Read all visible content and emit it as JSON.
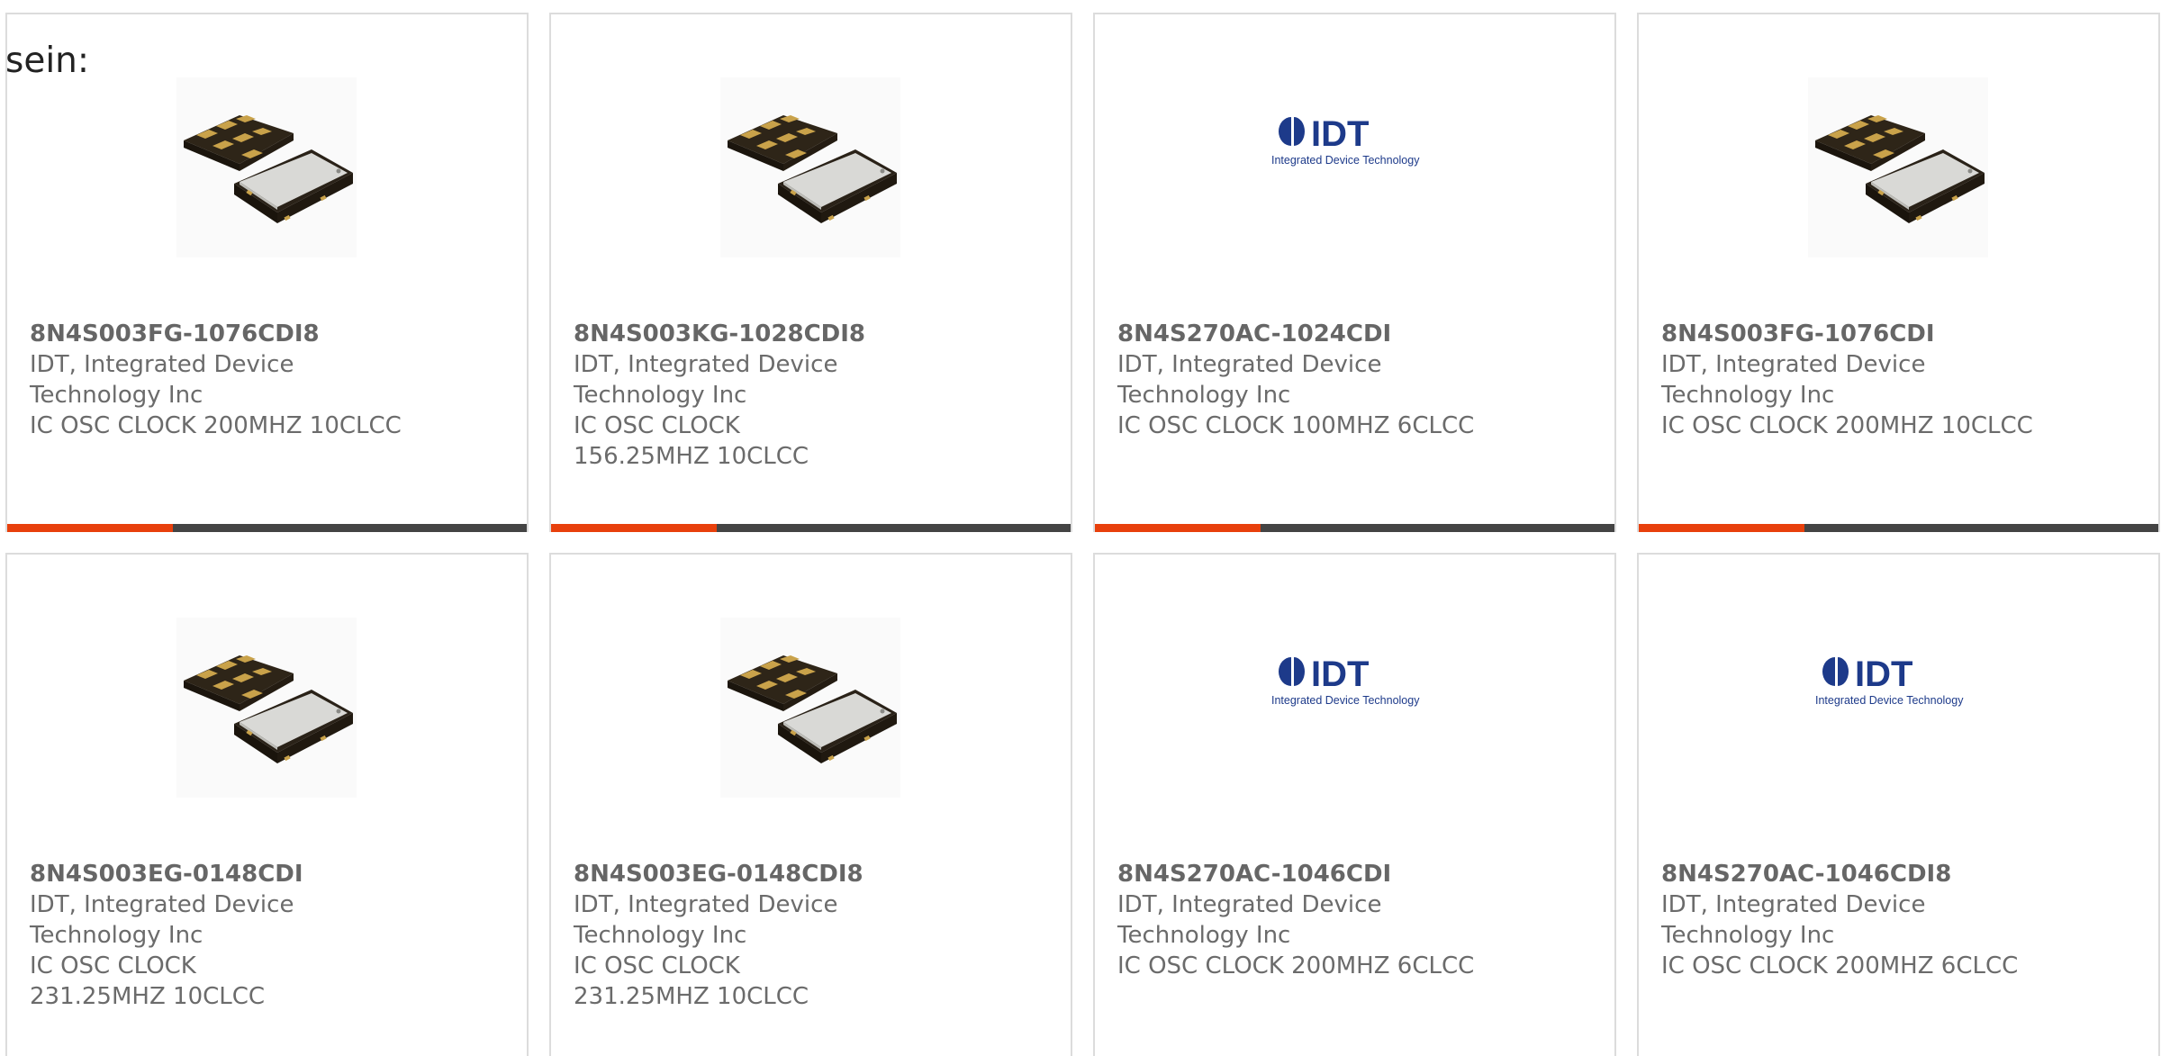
{
  "intro_text": "sein:",
  "colors": {
    "accent": "#e8400c",
    "bar": "#444444",
    "border": "#dcdcdc",
    "logo_blue": "#1d3a8a"
  },
  "products": [
    {
      "part_number": "8N4S003FG-1076CDI8",
      "manufacturer_line1": "IDT, Integrated Device",
      "manufacturer_line2": "Technology Inc",
      "description": "IC OSC CLOCK 200MHZ 10CLCC",
      "image": "oscillator-chip"
    },
    {
      "part_number": "8N4S003KG-1028CDI8",
      "manufacturer_line1": "IDT, Integrated Device",
      "manufacturer_line2": "Technology Inc",
      "description": "IC OSC CLOCK 156.25MHZ 10CLCC",
      "image": "oscillator-chip"
    },
    {
      "part_number": "8N4S270AC-1024CDI",
      "manufacturer_line1": "IDT, Integrated Device",
      "manufacturer_line2": "Technology Inc",
      "description": "IC OSC CLOCK 100MHZ 6CLCC",
      "image": "idt-logo"
    },
    {
      "part_number": "8N4S003FG-1076CDI",
      "manufacturer_line1": "IDT, Integrated Device",
      "manufacturer_line2": "Technology Inc",
      "description": "IC OSC CLOCK 200MHZ 10CLCC",
      "image": "oscillator-chip"
    },
    {
      "part_number": "8N4S003EG-0148CDI",
      "manufacturer_line1": "IDT, Integrated Device",
      "manufacturer_line2": "Technology Inc",
      "description": "IC OSC CLOCK 231.25MHZ 10CLCC",
      "image": "oscillator-chip"
    },
    {
      "part_number": "8N4S003EG-0148CDI8",
      "manufacturer_line1": "IDT, Integrated Device",
      "manufacturer_line2": "Technology Inc",
      "description": "IC OSC CLOCK 231.25MHZ 10CLCC",
      "image": "oscillator-chip"
    },
    {
      "part_number": "8N4S270AC-1046CDI",
      "manufacturer_line1": "IDT, Integrated Device",
      "manufacturer_line2": "Technology Inc",
      "description": "IC OSC CLOCK 200MHZ 6CLCC",
      "image": "idt-logo"
    },
    {
      "part_number": "8N4S270AC-1046CDI8",
      "manufacturer_line1": "IDT, Integrated Device",
      "manufacturer_line2": "Technology Inc",
      "description": "IC OSC CLOCK 200MHZ 6CLCC",
      "image": "idt-logo"
    }
  ],
  "logo": {
    "mark_text": "IDT",
    "tagline": "Integrated Device Technology"
  }
}
